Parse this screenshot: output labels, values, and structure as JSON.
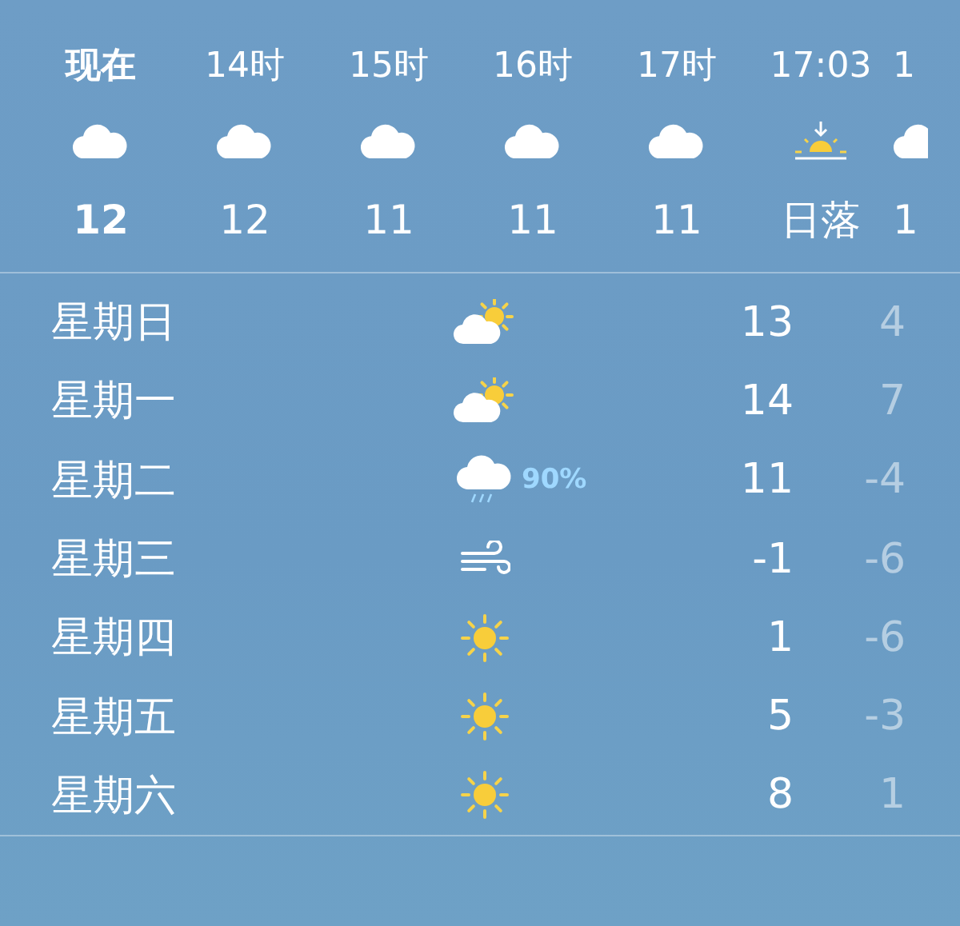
{
  "hourly": [
    {
      "time": "现在",
      "kind": "cloud",
      "temp": "12",
      "now": true
    },
    {
      "time": "14时",
      "kind": "cloud",
      "temp": "12",
      "now": false
    },
    {
      "time": "15时",
      "kind": "cloud",
      "temp": "11",
      "now": false
    },
    {
      "time": "16时",
      "kind": "cloud",
      "temp": "11",
      "now": false
    },
    {
      "time": "17时",
      "kind": "cloud",
      "temp": "11",
      "now": false
    },
    {
      "time": "17:03",
      "kind": "sunset",
      "temp": "日落",
      "now": false
    },
    {
      "time": "1",
      "kind": "cloud",
      "temp": "1",
      "now": false
    }
  ],
  "daily": [
    {
      "day": "星期日",
      "kind": "partly-cloudy",
      "high": "13",
      "low": "4"
    },
    {
      "day": "星期一",
      "kind": "partly-cloudy",
      "high": "14",
      "low": "7"
    },
    {
      "day": "星期二",
      "kind": "rain",
      "precipitation": "90%",
      "high": "11",
      "low": "-4"
    },
    {
      "day": "星期三",
      "kind": "wind",
      "high": "-1",
      "low": "-6"
    },
    {
      "day": "星期四",
      "kind": "sun",
      "high": "1",
      "low": "-6"
    },
    {
      "day": "星期五",
      "kind": "sun",
      "high": "5",
      "low": "-3"
    },
    {
      "day": "星期六",
      "kind": "sun",
      "high": "8",
      "low": "1"
    }
  ]
}
